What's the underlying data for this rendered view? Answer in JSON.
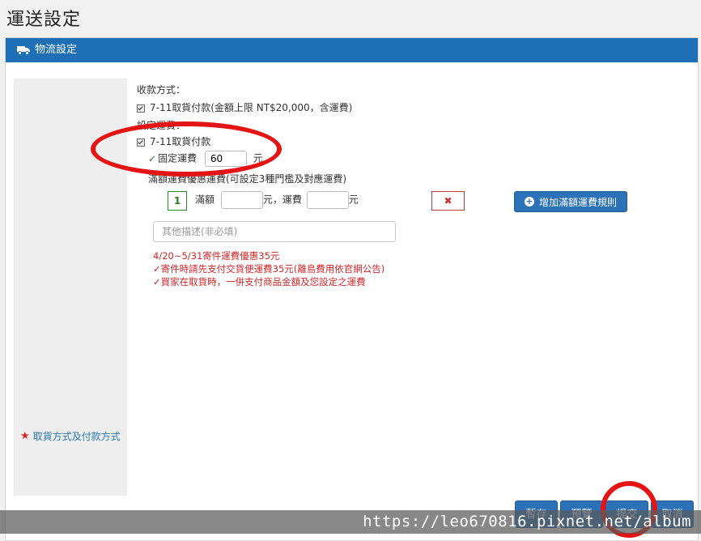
{
  "page": {
    "title": "運送設定"
  },
  "panel": {
    "header_label": "物流設定",
    "header_icon": "truck-icon"
  },
  "sidebar": {
    "label": "取貨方式及付款方式",
    "icon": "star-icon"
  },
  "collection": {
    "heading": "收款方式：",
    "option_label": "7-11取貨付款(金額上限 NT$20,000，含運費)"
  },
  "shipping": {
    "heading": "設定運費：",
    "method_label": "7-11取貨付款",
    "fixed_fee_label": "固定運費",
    "fixed_fee_value": "60",
    "fixed_fee_unit": "元",
    "threshold_hint": "滿額運費優惠運費(可設定3種門檻及對應運費)",
    "rule_number": "1",
    "threshold_label": "滿額",
    "threshold_unit": "元，運費",
    "fee_unit": "元",
    "delete_symbol": "✖",
    "add_rule_label": "增加滿額運費規則",
    "note_placeholder": "其他描述(非必填)"
  },
  "notes": {
    "line1": "4/20~5/31寄件運費優惠35元",
    "line2": "寄件時請先支付交貨便運費35元(離島費用依官網公告)",
    "line3": "買家在取貨時，一併支付商品金額及您設定之運費"
  },
  "footer": {
    "save_draft": "暫存",
    "preview": "預覽",
    "submit": "提交",
    "cancel": "取消"
  },
  "watermark": "https://leo670816.pixnet.net/album",
  "colors": {
    "header": "#1e6fb5",
    "button": "#2c72b8",
    "danger": "#d0262a",
    "annotation": "#e41414"
  }
}
